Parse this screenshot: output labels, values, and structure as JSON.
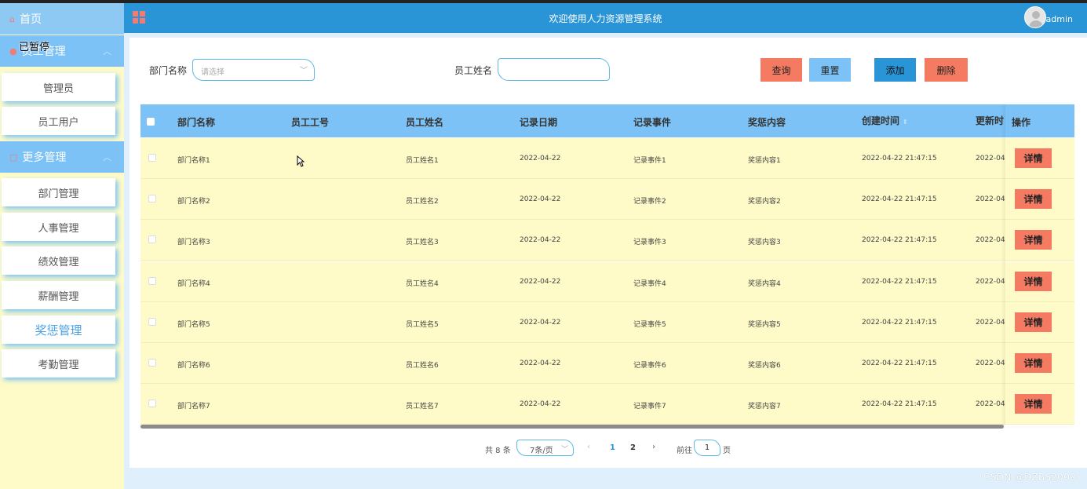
{
  "header": {
    "title": "欢迎使用人力资源管理系统",
    "user": "admin"
  },
  "sidebar": {
    "home": "首页",
    "group1": "员工管理",
    "group1_items": [
      "管理员",
      "员工用户"
    ],
    "group2": "更多管理",
    "group2_items": [
      "部门管理",
      "人事管理",
      "绩效管理",
      "薪酬管理",
      "奖惩管理",
      "考勤管理"
    ],
    "active_item": "奖惩管理"
  },
  "overlay_text": "已暂停",
  "search": {
    "dept_label": "部门名称",
    "dept_placeholder": "请选择",
    "name_label": "员工姓名",
    "name_value": ""
  },
  "buttons": {
    "query": "查询",
    "reset": "重置",
    "add": "添加",
    "delete": "删除",
    "detail": "详情"
  },
  "table": {
    "columns": [
      "部门名称",
      "员工工号",
      "员工姓名",
      "记录日期",
      "记录事件",
      "奖惩内容",
      "创建时间",
      "更新时",
      "操作"
    ],
    "rows": [
      [
        "部门名称1",
        "",
        "员工姓名1",
        "2022-04-22",
        "记录事件1",
        "奖惩内容1",
        "2022-04-22 21:47:15",
        "2022-04"
      ],
      [
        "部门名称2",
        "",
        "员工姓名2",
        "2022-04-22",
        "记录事件2",
        "奖惩内容2",
        "2022-04-22 21:47:15",
        "2022-04"
      ],
      [
        "部门名称3",
        "",
        "员工姓名3",
        "2022-04-22",
        "记录事件3",
        "奖惩内容3",
        "2022-04-22 21:47:15",
        "2022-04"
      ],
      [
        "部门名称4",
        "",
        "员工姓名4",
        "2022-04-22",
        "记录事件4",
        "奖惩内容4",
        "2022-04-22 21:47:15",
        "2022-04"
      ],
      [
        "部门名称5",
        "",
        "员工姓名5",
        "2022-04-22",
        "记录事件5",
        "奖惩内容5",
        "2022-04-22 21:47:15",
        "2022-04"
      ],
      [
        "部门名称6",
        "",
        "员工姓名6",
        "2022-04-22",
        "记录事件6",
        "奖惩内容6",
        "2022-04-22 21:47:15",
        "2022-04"
      ],
      [
        "部门名称7",
        "",
        "员工姓名7",
        "2022-04-22",
        "记录事件7",
        "奖惩内容7",
        "2022-04-22 21:47:15",
        "2022-04"
      ]
    ]
  },
  "pagination": {
    "total": "共 8 条",
    "page_size": "7条/页",
    "prev": "‹",
    "pages": [
      "1",
      "2"
    ],
    "next": "›",
    "goto_prefix": "前往",
    "goto_value": "1",
    "goto_suffix": "页"
  },
  "watermark": "CSDN @DZBS2000",
  "colors": {
    "sidebar_bg": "#fefbc8",
    "header_bg": "#2a95d6",
    "accent_light": "#7cc2f6",
    "danger": "#f47a62",
    "active_text": "#4aa3e8"
  }
}
